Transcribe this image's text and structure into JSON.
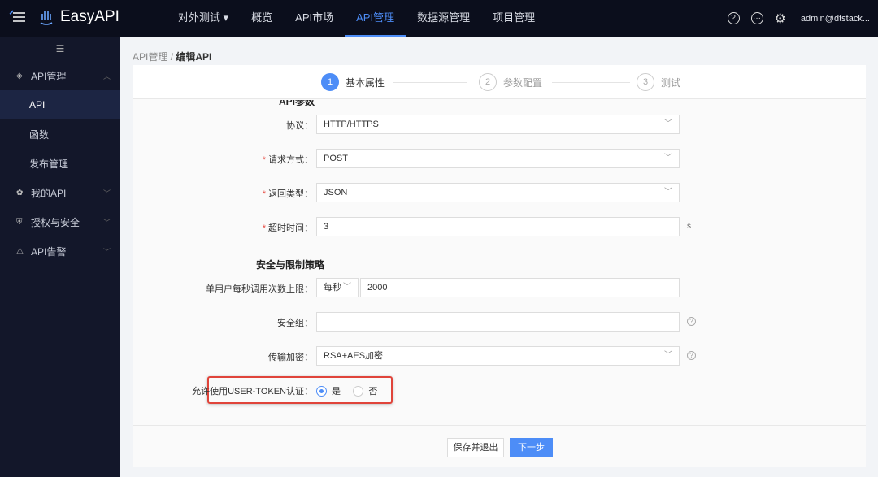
{
  "header": {
    "app_name": "EasyAPI",
    "project": "对外测试",
    "nav": [
      "概览",
      "API市场",
      "API管理",
      "数据源管理",
      "项目管理"
    ],
    "active_nav": "API管理",
    "user": "admin@dtstack...",
    "accent": "#4d8df7"
  },
  "sidebar": {
    "items": [
      {
        "label": "API管理",
        "icon": "layers-icon",
        "expanded": true
      },
      {
        "label": "API",
        "sub": true,
        "selected": true
      },
      {
        "label": "函数",
        "sub": true
      },
      {
        "label": "发布管理",
        "sub": true
      },
      {
        "label": "我的API",
        "icon": "api-group-icon"
      },
      {
        "label": "授权与安全",
        "icon": "shield-icon"
      },
      {
        "label": "API告警",
        "icon": "alarm-icon"
      }
    ]
  },
  "breadcrumb": {
    "parent": "API管理",
    "separator": "/",
    "current": "编辑API"
  },
  "steps": [
    {
      "num": "1",
      "label": "基本属性"
    },
    {
      "num": "2",
      "label": "参数配置"
    },
    {
      "num": "3",
      "label": "测试"
    }
  ],
  "form": {
    "section1": "API参数",
    "protocol": {
      "label": "协议：",
      "value": "HTTP/HTTPS"
    },
    "method": {
      "label": "请求方式：",
      "value": "POST",
      "required": true
    },
    "return_type": {
      "label": "返回类型：",
      "value": "JSON",
      "required": true
    },
    "timeout": {
      "label": "超时时间：",
      "value": "3",
      "unit": "s",
      "required": true
    },
    "section2": "安全与限制策略",
    "rate_limit": {
      "label": "单用户每秒调用次数上限：",
      "unit": "每秒",
      "value": "2000"
    },
    "security_group": {
      "label": "安全组：",
      "value": ""
    },
    "encryption": {
      "label": "传输加密：",
      "value": "RSA+AES加密"
    },
    "user_token": {
      "label": "允许使用USER-TOKEN认证：",
      "options": [
        "是",
        "否"
      ],
      "selected": "是"
    }
  },
  "footer": {
    "save_exit": "保存并退出",
    "next": "下一步"
  }
}
